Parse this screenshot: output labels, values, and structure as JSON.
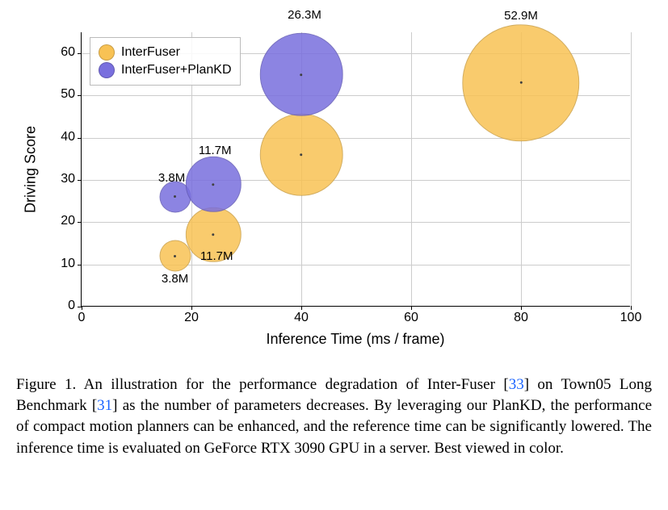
{
  "chart_data": {
    "type": "scatter",
    "title": "",
    "xlabel": "Inference Time (ms / frame)",
    "ylabel": "Driving Score",
    "xlim": [
      0,
      100
    ],
    "ylim": [
      0,
      65
    ],
    "xticks": [
      0,
      20,
      40,
      60,
      80,
      100
    ],
    "yticks": [
      0,
      10,
      20,
      30,
      40,
      50,
      60
    ],
    "series": [
      {
        "name": "InterFuser",
        "color": "#f8c254",
        "points": [
          {
            "x": 17,
            "y": 12,
            "size": 3.8,
            "label": "3.8M"
          },
          {
            "x": 24,
            "y": 17,
            "size": 11.7,
            "label": "11.7M"
          },
          {
            "x": 40,
            "y": 36,
            "size": 26.3,
            "label": "26.3M"
          },
          {
            "x": 80,
            "y": 53,
            "size": 52.9,
            "label": "52.9M"
          }
        ]
      },
      {
        "name": "InterFuser+PlanKD",
        "color": "#796fde",
        "points": [
          {
            "x": 17,
            "y": 26,
            "size": 3.8,
            "label": "3.8M"
          },
          {
            "x": 24,
            "y": 29,
            "size": 11.7,
            "label": "11.7M"
          },
          {
            "x": 40,
            "y": 55,
            "size": 26.3,
            "label": "26.3M"
          }
        ]
      }
    ]
  },
  "legend": {
    "items": [
      {
        "label": "InterFuser",
        "color": "#f8c254"
      },
      {
        "label": "InterFuser+PlanKD",
        "color": "#796fde"
      }
    ]
  },
  "caption": {
    "prefix": "Figure 1.",
    "text_1": " An illustration for the performance degradation of Inter-Fuser [",
    "ref1": "33",
    "text_2": "] on Town05 Long Benchmark [",
    "ref2": "31",
    "text_3": "] as the number of parameters decreases. By leveraging our PlanKD, the performance of compact motion planners can be enhanced, and the reference time can be significantly lowered. The inference time is evaluated on GeForce RTX 3090 GPU in a server. Best viewed in color."
  }
}
